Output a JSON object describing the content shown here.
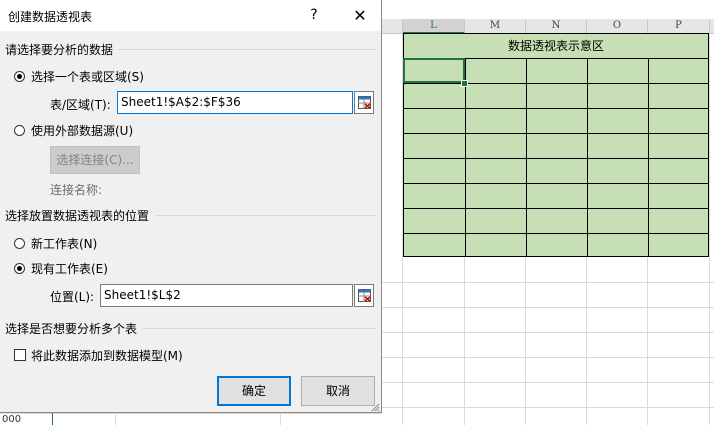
{
  "dialog": {
    "title": "创建数据透视表",
    "help": "?",
    "close": "✕",
    "section_source": "请选择要分析的数据",
    "opt_table_range": "选择一个表或区域(S)",
    "range_label": "表/区域(T):",
    "range_value": "Sheet1!$A$2:$F$36",
    "opt_external": "使用外部数据源(U)",
    "choose_connection": "选择连接(C)...",
    "connection_name_label": "连接名称:",
    "section_location": "选择放置数据透视表的位置",
    "opt_new_sheet": "新工作表(N)",
    "opt_existing_sheet": "现有工作表(E)",
    "location_label": "位置(L):",
    "location_value": "Sheet1!$L$2",
    "section_multi": "选择是否想要分析多个表",
    "add_to_model": "将此数据添加到数据模型(M)",
    "ok": "确定",
    "cancel": "取消"
  },
  "sheet": {
    "columns": [
      "L",
      "M",
      "N",
      "O",
      "P"
    ],
    "active_column": "L",
    "pivot_area_label": "数据透视表示意区",
    "row_number_partial": "000"
  },
  "colors": {
    "pivot_fill": "#c6dfb4",
    "accent": "#0078d7",
    "excel_green": "#217346"
  },
  "icons": {
    "range_selector": "range-picker-icon",
    "close": "close-icon",
    "help": "help-icon",
    "resize": "resize-grip-icon"
  }
}
